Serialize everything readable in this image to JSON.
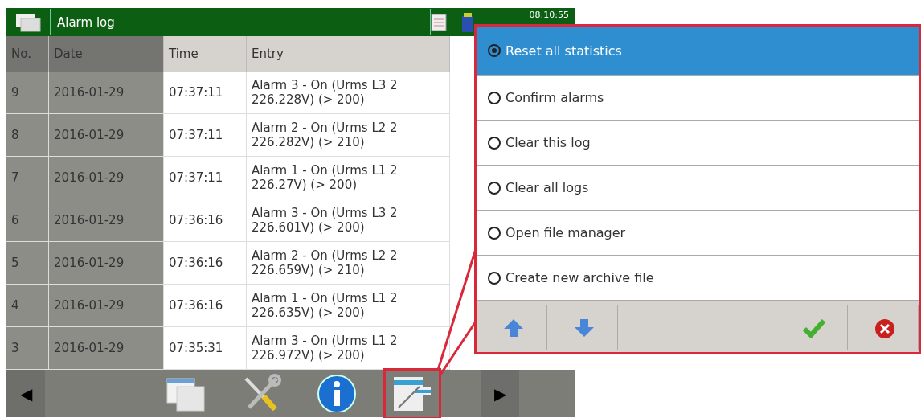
{
  "title_bar": {
    "title": "Alarm log",
    "time": "08:10:55"
  },
  "table": {
    "columns": [
      "No.",
      "Date",
      "Time",
      "Entry"
    ],
    "rows": [
      {
        "no": "9",
        "date": "2016-01-29",
        "time": "07:37:11",
        "entry_lines": [
          "Alarm 3 - On (Urms L3 2",
          "226.228V) (> 200)"
        ]
      },
      {
        "no": "8",
        "date": "2016-01-29",
        "time": "07:37:11",
        "entry_lines": [
          "Alarm 2 - On (Urms L2 2",
          "226.282V) (> 210)"
        ]
      },
      {
        "no": "7",
        "date": "2016-01-29",
        "time": "07:37:11",
        "entry_lines": [
          "Alarm 1 - On (Urms L1 2",
          "226.27V) (> 200)"
        ]
      },
      {
        "no": "6",
        "date": "2016-01-29",
        "time": "07:36:16",
        "entry_lines": [
          "Alarm 3 - On (Urms L3 2",
          "226.601V) (> 200)"
        ]
      },
      {
        "no": "5",
        "date": "2016-01-29",
        "time": "07:36:16",
        "entry_lines": [
          "Alarm 2 - On (Urms L2 2",
          "226.659V) (> 210)"
        ]
      },
      {
        "no": "4",
        "date": "2016-01-29",
        "time": "07:36:16",
        "entry_lines": [
          "Alarm 1 - On (Urms L1 2",
          "226.635V) (> 200)"
        ]
      },
      {
        "no": "3",
        "date": "2016-01-29",
        "time": "07:35:31",
        "entry_lines": [
          "Alarm 3 - On (Urms L1 2",
          "226.972V) (> 200)"
        ]
      }
    ]
  },
  "toolbar": {
    "previous_label": "◀",
    "next_label": "▶",
    "items": [
      {
        "kind": "windows",
        "highlighted": false
      },
      {
        "kind": "tools",
        "highlighted": false
      },
      {
        "kind": "info",
        "highlighted": false
      },
      {
        "kind": "notes",
        "highlighted": true
      }
    ]
  },
  "popup": {
    "options": [
      {
        "label": "Reset all statistics",
        "selected": true
      },
      {
        "label": "Confirm alarms",
        "selected": false
      },
      {
        "label": "Clear this log",
        "selected": false
      },
      {
        "label": "Clear all logs",
        "selected": false
      },
      {
        "label": "Open file manager",
        "selected": false
      },
      {
        "label": "Create new archive file",
        "selected": false
      }
    ],
    "buttons": [
      {
        "kind": "up"
      },
      {
        "kind": "down"
      },
      {
        "kind": "spacer"
      },
      {
        "kind": "ok"
      },
      {
        "kind": "cancel"
      }
    ]
  }
}
